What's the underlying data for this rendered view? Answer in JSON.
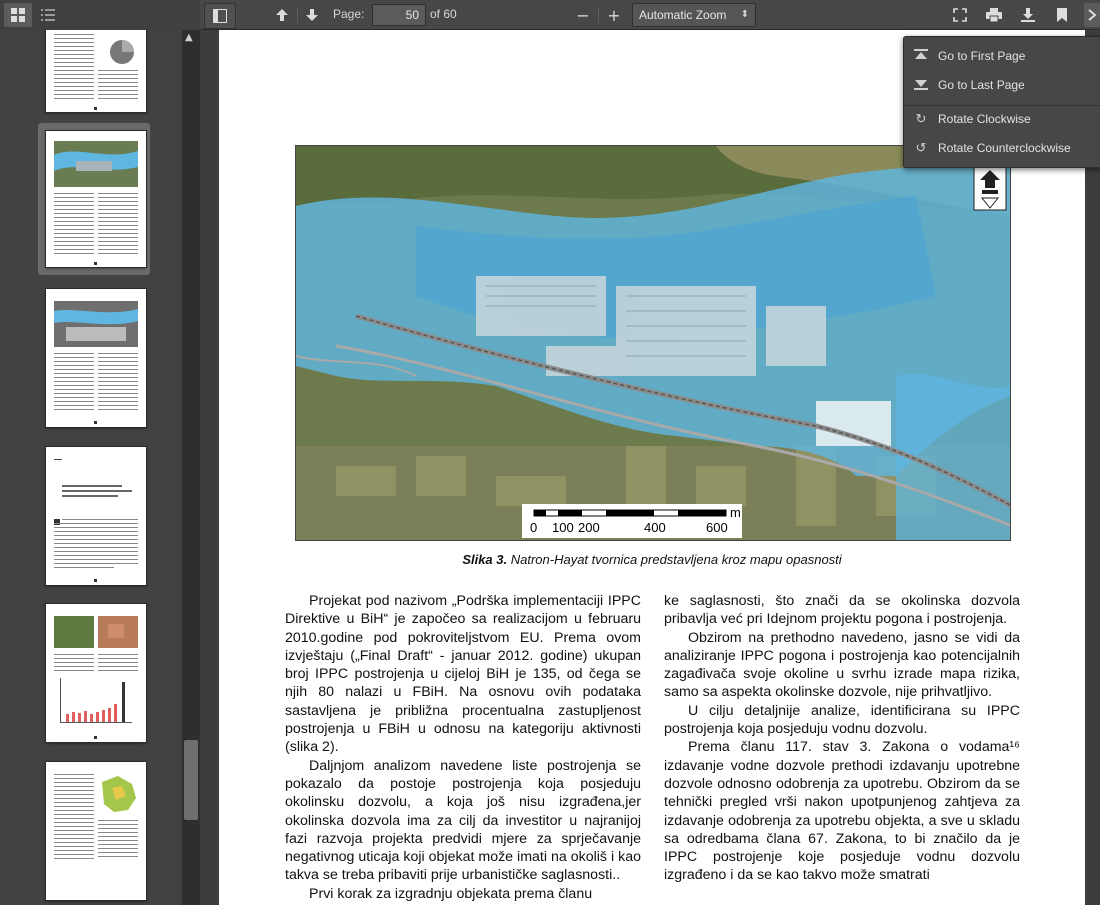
{
  "toolbar": {
    "page_label": "Page:",
    "page_value": "50",
    "page_total": "of 60",
    "zoom_value": "Automatic Zoom",
    "zoom_out": "−",
    "zoom_in": "+"
  },
  "menu": {
    "items": [
      {
        "label": "Go to First Page",
        "icon": "first-page-icon"
      },
      {
        "label": "Go to Last Page",
        "icon": "last-page-icon"
      },
      {
        "label": "Rotate Clockwise",
        "icon": "rotate-cw-icon"
      },
      {
        "label": "Rotate Counterclockwise",
        "icon": "rotate-ccw-icon"
      }
    ]
  },
  "document": {
    "map_scale_labels": [
      "0",
      "100",
      "200",
      "400",
      "600"
    ],
    "map_scale_unit": "m",
    "caption_bold": "Slika 3.",
    "caption_text": " Natron-Hayat tvornica predstavljena kroz mapu opasnosti",
    "left_column": [
      "Projekat pod nazivom „Podrška implementaciji IPPC Direktive u BiH“ je započeo sa realizacijom u februaru 2010.godine pod pokroviteljstvom EU. Prema ovom izvještaju („Final Draft“ - januar 2012. godine) ukupan broj IPPC postrojenja u cijeloj BiH je 135, od čega se njih 80 nalazi u FBiH. Na osnovu ovih podataka sastavljena je približna procentualna zastupljenost postrojenja u FBiH u odnosu na kategoriju aktivnosti (slika 2).",
      "Daljnjom analizom navedene liste postrojenja se pokazalo da postoje postrojenja koja posjeduju okolinsku dozvolu, a koja još nisu izgrađena,jer okolinska dozvola ima za cilj da investitor u najranijoj fazi razvoja projekta predvidi mjere za sprječavanje negativnog uticaja koji objekat može imati na okoliš i kao takva se treba pribaviti prije urbanističke saglasnosti..",
      "Prvi korak za izgradnju objekata prema članu"
    ],
    "right_column": [
      "ke saglasnosti, što znači da se okolinska dozvola pribavlja već pri Idejnom projektu pogona i postrojenja.",
      "Obzirom na prethodno navedeno, jasno se vidi da analiziranje IPPC pogona i postrojenja kao potencijalnih zagađivača svoje okoline u svrhu izrade mapa rizika, samo sa aspekta okolinske dozvole, nije prihvatljivo.",
      "U cilju detaljnije analize, identificirana su IPPC postrojenja koja posjeduju vodnu dozvolu.",
      "Prema članu 117. stav 3. Zakona o vodama¹⁶ izdavanje vodne dozvole prethodi izdavanju upotrebne dozvole odnosno odobrenja za upotrebu. Obzirom da se tehnički pregled vrši nakon upotpunjenog zahtjeva za izdavanje odobrenja za upotrebu objekta, a sve u skladu sa odredbama člana 67. Zakona, to bi značilo da je IPPC postrojenje koje posjeduje vodnu dozvolu izgrađeno i da se kao takvo može smatrati"
    ]
  },
  "colors": {
    "toolbar_bg": "#474747",
    "sidebar_bg": "#424242",
    "viewer_bg": "#3d3d3d",
    "flood_blue": "#5fb6e0"
  }
}
